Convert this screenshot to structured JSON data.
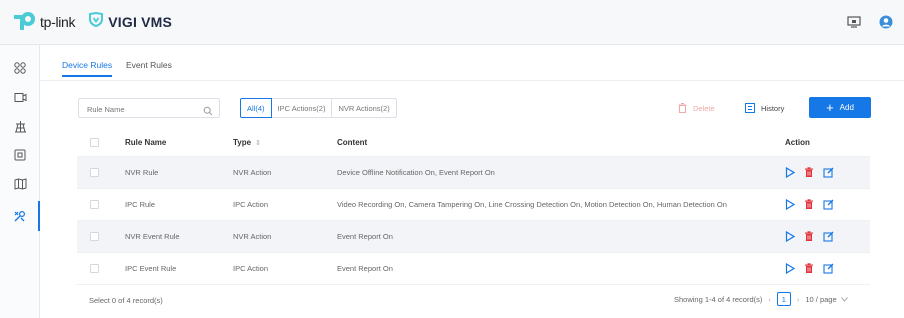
{
  "app": {
    "brand": "tp-link",
    "product": "VIGI VMS"
  },
  "tabs": [
    {
      "label": "Device Rules"
    },
    {
      "label": "Event Rules"
    }
  ],
  "search": {
    "placeholder": "Rule Name"
  },
  "filters": [
    {
      "label": "All(4)"
    },
    {
      "label": "IPC Actions(2)"
    },
    {
      "label": "NVR Actions(2)"
    }
  ],
  "toolbar": {
    "delete_label": "Delete",
    "history_label": "History",
    "add_label": "Add"
  },
  "table": {
    "headers": {
      "name": "Rule Name",
      "type": "Type",
      "content": "Content",
      "action": "Action"
    },
    "rows": [
      {
        "name": "NVR Rule",
        "type": "NVR Action",
        "content": "Device Offline Notification On, Event Report On"
      },
      {
        "name": "IPC Rule",
        "type": "IPC Action",
        "content": "Video Recording On, Camera Tampering On, Line Crossing Detection On, Motion Detection On, Human Detection On"
      },
      {
        "name": "NVR Event Rule",
        "type": "NVR Action",
        "content": "Event Report On"
      },
      {
        "name": "IPC Event Rule",
        "type": "IPC Action",
        "content": "Event Report On"
      }
    ]
  },
  "footer": {
    "selection": "Select 0 of 4 record(s)",
    "showing": "Showing 1-4 of 4 record(s)",
    "page": "1",
    "page_size": "10 / page"
  },
  "colors": {
    "accent": "#1677e6",
    "delete": "#e0353b",
    "brand_teal": "#4acbd6"
  }
}
